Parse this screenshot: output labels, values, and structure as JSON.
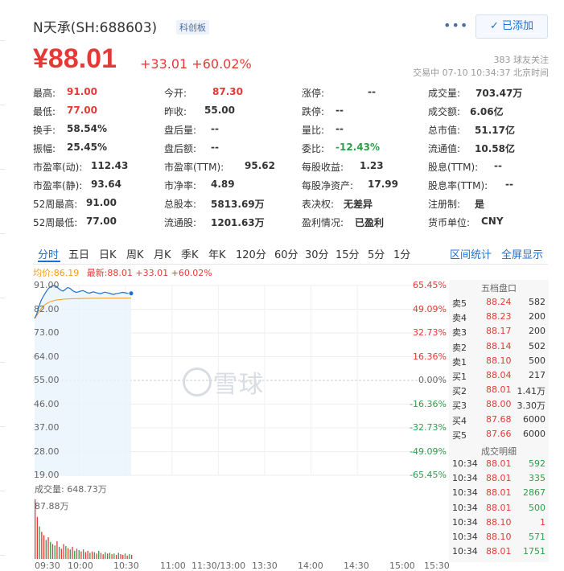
{
  "header": {
    "name": "N天承(SH:688603)",
    "board": "科创板",
    "more": "•••",
    "follow_label": "✓ 已添加",
    "price": "¥88.01",
    "change": "+33.01 +60.02%",
    "followers": "383 球友关注",
    "status": "交易中 07-10 10:34:37 北京时间"
  },
  "quote": [
    [
      {
        "label": "最高:",
        "value": "91.00",
        "color": "up"
      },
      {
        "label": "今开:",
        "value": "87.30",
        "color": "up"
      },
      {
        "label": "涨停:",
        "value": "--"
      },
      {
        "label": "成交量:",
        "value": "703.47万"
      }
    ],
    [
      {
        "label": "最低:",
        "value": "77.00",
        "color": "up"
      },
      {
        "label": "昨收:",
        "value": "55.00"
      },
      {
        "label": "跌停:",
        "value": "--"
      },
      {
        "label": "成交额:",
        "value": "6.06亿"
      }
    ],
    [
      {
        "label": "换手:",
        "value": "58.54%"
      },
      {
        "label": "盘后量:",
        "value": "--"
      },
      {
        "label": "量比:",
        "value": "--"
      },
      {
        "label": "总市值:",
        "value": "51.17亿"
      }
    ],
    [
      {
        "label": "振幅:",
        "value": "25.45%"
      },
      {
        "label": "盘后额:",
        "value": "--"
      },
      {
        "label": "委比:",
        "value": "-12.43%",
        "color": "down"
      },
      {
        "label": "流通值:",
        "value": "10.58亿"
      }
    ],
    [
      {
        "label": "市盈率(动):",
        "value": "112.43"
      },
      {
        "label": "市盈率(TTM):",
        "value": "95.62"
      },
      {
        "label": "每股收益:",
        "value": "1.23"
      },
      {
        "label": "股息(TTM):",
        "value": "--"
      }
    ],
    [
      {
        "label": "市盈率(静):",
        "value": "93.64"
      },
      {
        "label": "市净率:",
        "value": "4.89"
      },
      {
        "label": "每股净资产:",
        "value": "17.99"
      },
      {
        "label": "股息率(TTM):",
        "value": "--"
      }
    ],
    [
      {
        "label": "52周最高:",
        "value": "91.00"
      },
      {
        "label": "总股本:",
        "value": "5813.69万"
      },
      {
        "label": "表决权:",
        "value": "无差异"
      },
      {
        "label": "注册制:",
        "value": "是"
      }
    ],
    [
      {
        "label": "52周最低:",
        "value": "77.00"
      },
      {
        "label": "流通股:",
        "value": "1201.63万"
      },
      {
        "label": "盈利情况:",
        "value": "已盈利"
      },
      {
        "label": "货币单位:",
        "value": "CNY"
      }
    ]
  ],
  "tabs": [
    "分时",
    "五日",
    "日K",
    "周K",
    "月K",
    "季K",
    "年K",
    "120分",
    "60分",
    "30分",
    "15分",
    "5分",
    "1分"
  ],
  "tab_links": [
    "区间统计",
    "全屏显示"
  ],
  "avg_line": {
    "avg": "均价:86.19",
    "latest": "最新:88.01 +33.01 +60.02%"
  },
  "chart_data": {
    "type": "line",
    "y_labels": [
      "91.00",
      "82.00",
      "73.00",
      "64.00",
      "55.00",
      "46.00",
      "37.00",
      "28.00",
      "19.00"
    ],
    "pct_labels": [
      "65.45%",
      "49.09%",
      "32.73%",
      "16.36%",
      "0.00%",
      "-16.36%",
      "-32.73%",
      "-49.09%",
      "-65.45%"
    ],
    "ylim": [
      19,
      91
    ],
    "x_labels": [
      "09:30",
      "10:00",
      "10:30",
      "11:00",
      "11:30/13:00",
      "13:30",
      "14:00",
      "14:30",
      "15:00",
      "15:30"
    ],
    "price_series": [
      78.5,
      80.2,
      83.1,
      85.4,
      86.9,
      88.3,
      89.6,
      90.4,
      90.8,
      91.0,
      90.6,
      89.8,
      89.2,
      88.9,
      89.5,
      90.2,
      90.0,
      89.3,
      88.7,
      88.4,
      88.6,
      88.9,
      89.1,
      88.7,
      88.3,
      88.1,
      88.4,
      88.6,
      88.3,
      88.1,
      87.9,
      88.2,
      88.5,
      88.3,
      88.1,
      87.8,
      87.6,
      87.9,
      88.0,
      88.2,
      88.4,
      88.3,
      88.1,
      88.0,
      88.01
    ],
    "avg_series": [
      78.5,
      79.6,
      81.0,
      82.3,
      83.2,
      83.9,
      84.4,
      84.8,
      85.1,
      85.3,
      85.5,
      85.6,
      85.7,
      85.8,
      85.85,
      85.9,
      85.95,
      86.0,
      86.02,
      86.04,
      86.06,
      86.08,
      86.1,
      86.11,
      86.12,
      86.13,
      86.14,
      86.15,
      86.15,
      86.16,
      86.16,
      86.17,
      86.17,
      86.17,
      86.18,
      86.18,
      86.18,
      86.18,
      86.19,
      86.19,
      86.19,
      86.19,
      86.19,
      86.19,
      86.19
    ],
    "volume_label": "成交量: 648.73万",
    "volume_max_label": "87.88万",
    "volume_max": 87.88,
    "volumes": [
      87.88,
      62,
      48,
      40,
      35,
      28,
      32,
      25,
      22,
      20,
      26,
      18,
      15,
      22,
      19,
      16,
      14,
      18,
      12,
      15,
      13,
      11,
      14,
      10,
      12,
      9,
      11,
      10,
      8,
      12,
      9,
      7,
      10,
      8,
      9,
      7,
      8,
      6,
      9,
      7,
      6,
      8,
      5,
      7,
      6
    ],
    "volume_up": [
      1,
      1,
      0,
      1,
      1,
      0,
      1,
      0,
      1,
      0,
      1,
      0,
      1,
      1,
      0,
      1,
      0,
      1,
      0,
      1,
      0,
      1,
      0,
      1,
      1,
      0,
      1,
      0,
      1,
      0,
      1,
      1,
      0,
      1,
      0,
      1,
      0,
      1,
      0,
      1,
      1,
      0,
      1,
      0,
      1
    ]
  },
  "watermark": "雪球",
  "orderbook": {
    "title": "五档盘口",
    "asks": [
      {
        "label": "卖5",
        "price": "88.24",
        "vol": "582"
      },
      {
        "label": "卖4",
        "price": "88.23",
        "vol": "200"
      },
      {
        "label": "卖3",
        "price": "88.17",
        "vol": "200"
      },
      {
        "label": "卖2",
        "price": "88.14",
        "vol": "502"
      },
      {
        "label": "卖1",
        "price": "88.10",
        "vol": "500"
      }
    ],
    "bids": [
      {
        "label": "买1",
        "price": "88.04",
        "vol": "217"
      },
      {
        "label": "买2",
        "price": "88.01",
        "vol": "1.41万"
      },
      {
        "label": "买3",
        "price": "88.00",
        "vol": "3.30万"
      },
      {
        "label": "买4",
        "price": "87.68",
        "vol": "6000"
      },
      {
        "label": "买5",
        "price": "87.66",
        "vol": "6000"
      }
    ],
    "trades_title": "成交明细",
    "trades": [
      {
        "time": "10:34",
        "price": "88.01",
        "vol": "592",
        "dir": "down"
      },
      {
        "time": "10:34",
        "price": "88.01",
        "vol": "335",
        "dir": "down"
      },
      {
        "time": "10:34",
        "price": "88.01",
        "vol": "2867",
        "dir": "down"
      },
      {
        "time": "10:34",
        "price": "88.01",
        "vol": "500",
        "dir": "down"
      },
      {
        "time": "10:34",
        "price": "88.10",
        "vol": "1",
        "dir": "up"
      },
      {
        "time": "10:34",
        "price": "88.10",
        "vol": "571",
        "dir": "down"
      },
      {
        "time": "10:34",
        "price": "88.01",
        "vol": "1751",
        "dir": "down"
      }
    ]
  },
  "colors": {
    "up": "#e53935",
    "down": "#2e9e49",
    "accent": "#1f6fcf"
  }
}
